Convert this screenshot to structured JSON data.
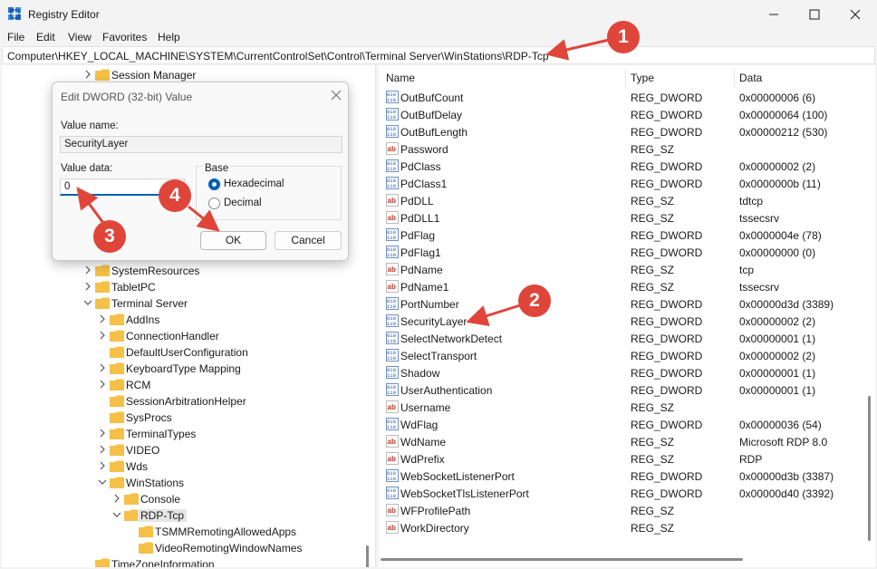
{
  "window": {
    "title": "Registry Editor"
  },
  "menu": [
    "File",
    "Edit",
    "View",
    "Favorites",
    "Help"
  ],
  "address": "Computer\\HKEY_LOCAL_MACHINE\\SYSTEM\\CurrentControlSet\\Control\\Terminal Server\\WinStations\\RDP-Tcp",
  "tree": {
    "nodes": [
      {
        "label": "Session Manager",
        "expand": "right"
      },
      {
        "label": "SystemResources",
        "expand": "right"
      },
      {
        "label": "TabletPC",
        "expand": "right"
      },
      {
        "label": "Terminal Server",
        "expand": "down"
      },
      {
        "label": "AddIns",
        "expand": "right"
      },
      {
        "label": "ConnectionHandler",
        "expand": "right"
      },
      {
        "label": "DefaultUserConfiguration",
        "expand": "none"
      },
      {
        "label": "KeyboardType Mapping",
        "expand": "right"
      },
      {
        "label": "RCM",
        "expand": "right"
      },
      {
        "label": "SessionArbitrationHelper",
        "expand": "none"
      },
      {
        "label": "SysProcs",
        "expand": "none"
      },
      {
        "label": "TerminalTypes",
        "expand": "right"
      },
      {
        "label": "VIDEO",
        "expand": "right"
      },
      {
        "label": "Wds",
        "expand": "right"
      },
      {
        "label": "WinStations",
        "expand": "down"
      },
      {
        "label": "Console",
        "expand": "right"
      },
      {
        "label": "RDP-Tcp",
        "expand": "down",
        "selected": true
      },
      {
        "label": "TSMMRemotingAllowedApps",
        "expand": "none"
      },
      {
        "label": "VideoRemotingWindowNames",
        "expand": "none"
      },
      {
        "label": "TimeZoneInformation",
        "expand": "none"
      }
    ]
  },
  "list": {
    "headers": {
      "name": "Name",
      "type": "Type",
      "data": "Data"
    },
    "rows": [
      {
        "name": "OutBufCount",
        "type": "REG_DWORD",
        "data": "0x00000006 (6)",
        "icon": "dword-value-icon"
      },
      {
        "name": "OutBufDelay",
        "type": "REG_DWORD",
        "data": "0x00000064 (100)",
        "icon": "dword-value-icon"
      },
      {
        "name": "OutBufLength",
        "type": "REG_DWORD",
        "data": "0x00000212 (530)",
        "icon": "dword-value-icon"
      },
      {
        "name": "Password",
        "type": "REG_SZ",
        "data": "",
        "icon": "string-value-icon"
      },
      {
        "name": "PdClass",
        "type": "REG_DWORD",
        "data": "0x00000002 (2)",
        "icon": "dword-value-icon"
      },
      {
        "name": "PdClass1",
        "type": "REG_DWORD",
        "data": "0x0000000b (11)",
        "icon": "dword-value-icon"
      },
      {
        "name": "PdDLL",
        "type": "REG_SZ",
        "data": "tdtcp",
        "icon": "string-value-icon"
      },
      {
        "name": "PdDLL1",
        "type": "REG_SZ",
        "data": "tssecsrv",
        "icon": "string-value-icon"
      },
      {
        "name": "PdFlag",
        "type": "REG_DWORD",
        "data": "0x0000004e (78)",
        "icon": "dword-value-icon"
      },
      {
        "name": "PdFlag1",
        "type": "REG_DWORD",
        "data": "0x00000000 (0)",
        "icon": "dword-value-icon"
      },
      {
        "name": "PdName",
        "type": "REG_SZ",
        "data": "tcp",
        "icon": "string-value-icon"
      },
      {
        "name": "PdName1",
        "type": "REG_SZ",
        "data": "tssecsrv",
        "icon": "string-value-icon"
      },
      {
        "name": "PortNumber",
        "type": "REG_DWORD",
        "data": "0x00000d3d (3389)",
        "icon": "dword-value-icon"
      },
      {
        "name": "SecurityLayer",
        "type": "REG_DWORD",
        "data": "0x00000002 (2)",
        "icon": "dword-value-icon"
      },
      {
        "name": "SelectNetworkDetect",
        "type": "REG_DWORD",
        "data": "0x00000001 (1)",
        "icon": "dword-value-icon"
      },
      {
        "name": "SelectTransport",
        "type": "REG_DWORD",
        "data": "0x00000002 (2)",
        "icon": "dword-value-icon"
      },
      {
        "name": "Shadow",
        "type": "REG_DWORD",
        "data": "0x00000001 (1)",
        "icon": "dword-value-icon"
      },
      {
        "name": "UserAuthentication",
        "type": "REG_DWORD",
        "data": "0x00000001 (1)",
        "icon": "dword-value-icon"
      },
      {
        "name": "Username",
        "type": "REG_SZ",
        "data": "",
        "icon": "string-value-icon"
      },
      {
        "name": "WdFlag",
        "type": "REG_DWORD",
        "data": "0x00000036 (54)",
        "icon": "dword-value-icon"
      },
      {
        "name": "WdName",
        "type": "REG_SZ",
        "data": "Microsoft RDP 8.0",
        "icon": "string-value-icon"
      },
      {
        "name": "WdPrefix",
        "type": "REG_SZ",
        "data": "RDP",
        "icon": "string-value-icon"
      },
      {
        "name": "WebSocketListenerPort",
        "type": "REG_DWORD",
        "data": "0x00000d3b (3387)",
        "icon": "dword-value-icon"
      },
      {
        "name": "WebSocketTlsListenerPort",
        "type": "REG_DWORD",
        "data": "0x00000d40 (3392)",
        "icon": "dword-value-icon"
      },
      {
        "name": "WFProfilePath",
        "type": "REG_SZ",
        "data": "",
        "icon": "string-value-icon"
      },
      {
        "name": "WorkDirectory",
        "type": "REG_SZ",
        "data": "",
        "icon": "string-value-icon"
      }
    ]
  },
  "dialog": {
    "title": "Edit DWORD (32-bit) Value",
    "value_name_label": "Value name:",
    "value_name": "SecurityLayer",
    "value_data_label": "Value data:",
    "value_data": "0",
    "base_label": "Base",
    "hex_label": "Hexadecimal",
    "dec_label": "Decimal",
    "ok_label": "OK",
    "cancel_label": "Cancel"
  },
  "annotations": [
    "1",
    "2",
    "3",
    "4"
  ],
  "colors": {
    "annotation": "#e0453a",
    "accent": "#005fb8",
    "folder": "#f5c048"
  }
}
